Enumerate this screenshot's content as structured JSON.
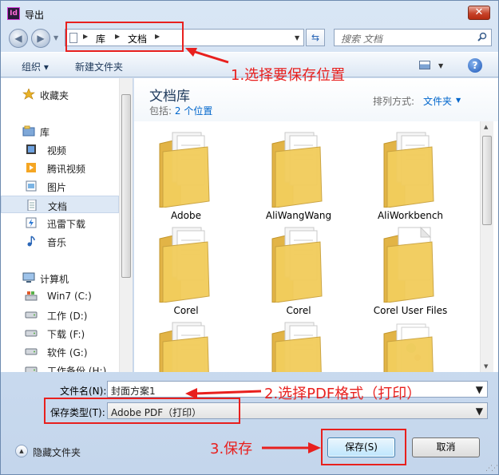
{
  "window": {
    "title": "导出",
    "app_icon_text": "Id",
    "close_symbol": "✕"
  },
  "address": {
    "segments": [
      "库",
      "文档"
    ],
    "search_placeholder": "搜索 文档"
  },
  "toolbar": {
    "organize_label": "组织 ▾",
    "new_folder_label": "新建文件夹",
    "help_symbol": "?"
  },
  "nav": {
    "items": [
      {
        "label": "收藏夹",
        "icon": "star-icon",
        "level": "top"
      },
      {
        "label": "库",
        "icon": "library-icon",
        "level": "top"
      },
      {
        "label": "视频",
        "icon": "video-icon",
        "level": "child"
      },
      {
        "label": "腾讯视频",
        "icon": "tencent-video-icon",
        "level": "child"
      },
      {
        "label": "图片",
        "icon": "picture-icon",
        "level": "child"
      },
      {
        "label": "文档",
        "icon": "document-icon",
        "level": "child",
        "selected": true
      },
      {
        "label": "迅雷下载",
        "icon": "thunder-download-icon",
        "level": "child"
      },
      {
        "label": "音乐",
        "icon": "music-icon",
        "level": "child"
      },
      {
        "label": "计算机",
        "icon": "computer-icon",
        "level": "top"
      },
      {
        "label": "Win7 (C:)",
        "icon": "system-drive-icon",
        "level": "child"
      },
      {
        "label": "工作 (D:)",
        "icon": "drive-icon",
        "level": "child"
      },
      {
        "label": "下载 (F:)",
        "icon": "drive-icon",
        "level": "child"
      },
      {
        "label": "软件 (G:)",
        "icon": "drive-icon",
        "level": "child"
      },
      {
        "label": "工作备份 (H:)",
        "icon": "drive-icon",
        "level": "child"
      }
    ]
  },
  "library": {
    "title": "文档库",
    "includes_prefix": "包括:",
    "includes_link": "2 个位置",
    "sort_label": "排列方式:",
    "sort_value": "文件夹"
  },
  "folders": [
    {
      "label": "Adobe",
      "style": "documents"
    },
    {
      "label": "AliWangWang",
      "style": "documents"
    },
    {
      "label": "AliWorkbench",
      "style": "documents"
    },
    {
      "label": "Corel",
      "style": "documents"
    },
    {
      "label": "Corel",
      "style": "documents"
    },
    {
      "label": "Corel User Files",
      "style": "blank"
    },
    {
      "label": "",
      "style": "documents"
    },
    {
      "label": "",
      "style": "documents"
    },
    {
      "label": "",
      "style": "images"
    }
  ],
  "fields": {
    "filename_label": "文件名(N):",
    "filename_value": "封面方案1",
    "filetype_label": "保存类型(T):",
    "filetype_value": "Adobe PDF（打印）"
  },
  "footer": {
    "hide_folders_label": "隐藏文件夹",
    "save_label": "保存(S)",
    "cancel_label": "取消"
  },
  "annotations": {
    "step1": "1.选择要保存位置",
    "step2": "2.选择PDF格式（打印）",
    "step3": "3.保存",
    "color": "#e8201e"
  },
  "colors": {
    "accent": "#1e395b",
    "link": "#0066cc",
    "folder": "#f2cd5c"
  }
}
